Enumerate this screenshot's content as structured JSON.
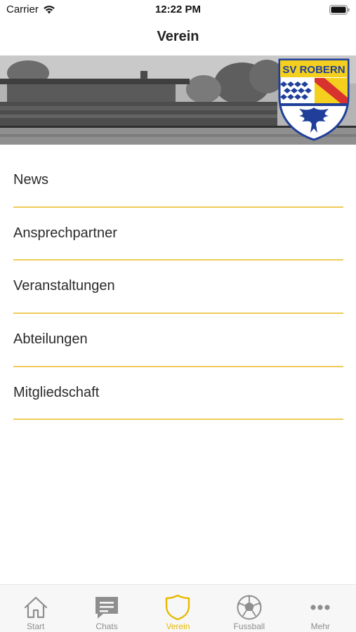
{
  "status_bar": {
    "carrier": "Carrier",
    "time": "12:22 PM"
  },
  "header": {
    "title": "Verein"
  },
  "banner": {
    "logo_text": "SV ROBERN"
  },
  "menu": {
    "items": [
      {
        "label": "News"
      },
      {
        "label": "Ansprechpartner"
      },
      {
        "label": "Veranstaltungen"
      },
      {
        "label": "Abteilungen"
      },
      {
        "label": "Mitgliedschaft"
      }
    ]
  },
  "tab_bar": {
    "active": "Verein",
    "tabs": [
      {
        "label": "Start",
        "icon": "home-icon"
      },
      {
        "label": "Chats",
        "icon": "chat-icon"
      },
      {
        "label": "Verein",
        "icon": "shield-icon"
      },
      {
        "label": "Fussball",
        "icon": "soccer-ball-icon"
      },
      {
        "label": "Mehr",
        "icon": "more-dots-icon"
      }
    ]
  },
  "colors": {
    "accent": "#e8b800",
    "divider": "#f0cb59",
    "inactive": "#8e8e8e",
    "logo_yellow": "#f4cf1e",
    "logo_blue": "#1f3f9a",
    "logo_red": "#d8322e"
  }
}
